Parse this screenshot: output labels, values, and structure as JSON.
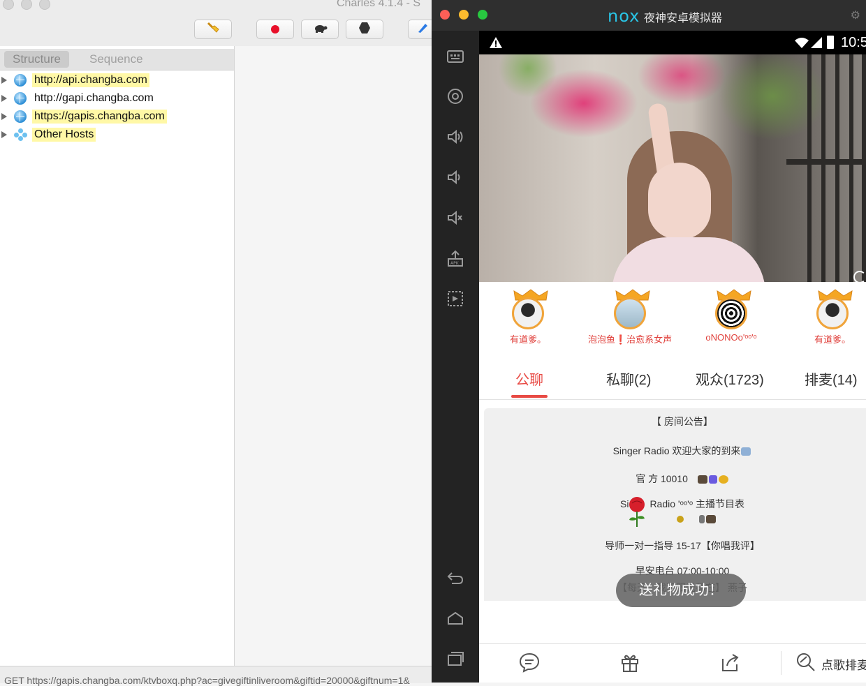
{
  "charles": {
    "title": "Charles 4.1.4 - S",
    "view_tabs": [
      "Structure",
      "Sequence"
    ],
    "hosts": [
      {
        "label": "http://api.changba.com",
        "icon": "globe-icon"
      },
      {
        "label": "http://gapi.changba.com",
        "icon": "globe-icon"
      },
      {
        "label": "https://gapis.changba.com",
        "icon": "globe-icon"
      },
      {
        "label": "Other Hosts",
        "icon": "hosts-cluster-icon"
      }
    ],
    "status_text": "GET https://gapis.changba.com/ktvboxq.php?ac=givegiftinliveroom&giftid=20000&giftnum=1&",
    "colors": {
      "highlight": "#fff8a6",
      "record": "#e8102a"
    }
  },
  "nox": {
    "logo": "nox",
    "title": "夜神安卓模拟器",
    "clock": "10:5",
    "sidebar_icons": [
      "keyboard-icon",
      "location-icon",
      "volume-up-icon",
      "volume-down-icon",
      "mute-icon",
      "apk-install-icon",
      "screen-record-icon",
      "back-icon",
      "home-icon",
      "recent-apps-icon"
    ]
  },
  "room": {
    "hosts": [
      {
        "name": "有道爹。"
      },
      {
        "name": "泡泡鱼❗治愈系女声"
      },
      {
        "name": "oNONOo'ᵒᵒ'ᵒ"
      },
      {
        "name": "有道爹。"
      }
    ],
    "tabs": [
      "公聊",
      "私聊(2)",
      "观众(1723)",
      "排麦(14)"
    ],
    "active_tab": 0,
    "announcement": {
      "title": "【 房间公告】",
      "welcome": "Singer Radio 欢迎大家的到来",
      "official": "官 方 10010",
      "schedule_a": "Si",
      "schedule_b": "Radio 'ᵒᵒ'ᵒ 主播节目表",
      "mentor": "导师一对一指导   15-17【你唱我评】",
      "morning": "早安电台   07:00-10:00",
      "morning_sub": "【每天，我和阳光都在】  燕子"
    },
    "toast": "送礼物成功！",
    "song_button": "点歌排麦",
    "accent_color": "#e84a44"
  }
}
